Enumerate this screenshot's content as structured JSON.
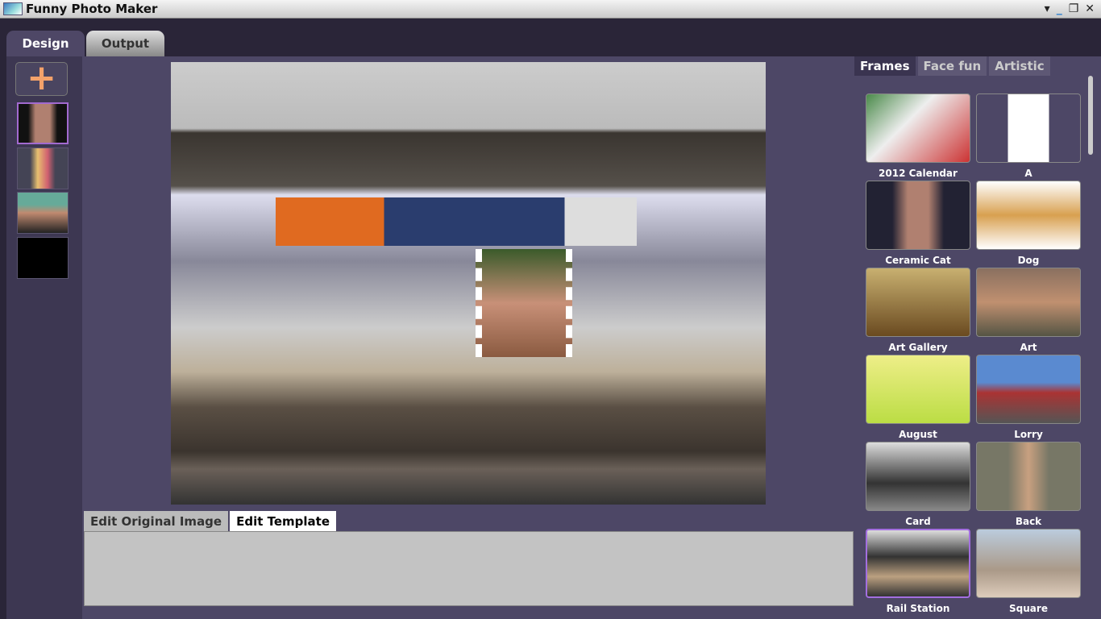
{
  "window": {
    "title": "Funny Photo Maker",
    "controls": [
      "▾",
      "_",
      "❐",
      "✕"
    ]
  },
  "main_tabs": [
    "Design",
    "Output"
  ],
  "left": {
    "add_label": "+"
  },
  "edit_tabs": [
    "Edit Original Image",
    "Edit Template"
  ],
  "right_tabs": [
    "Frames",
    "Face fun",
    "Artistic"
  ],
  "frames": [
    "2012 Calendar",
    "A",
    "Ceramic Cat",
    "Dog",
    "Art Gallery",
    "Art",
    "August",
    "Lorry",
    "Card",
    "Back",
    "Rail Station",
    "Square"
  ]
}
